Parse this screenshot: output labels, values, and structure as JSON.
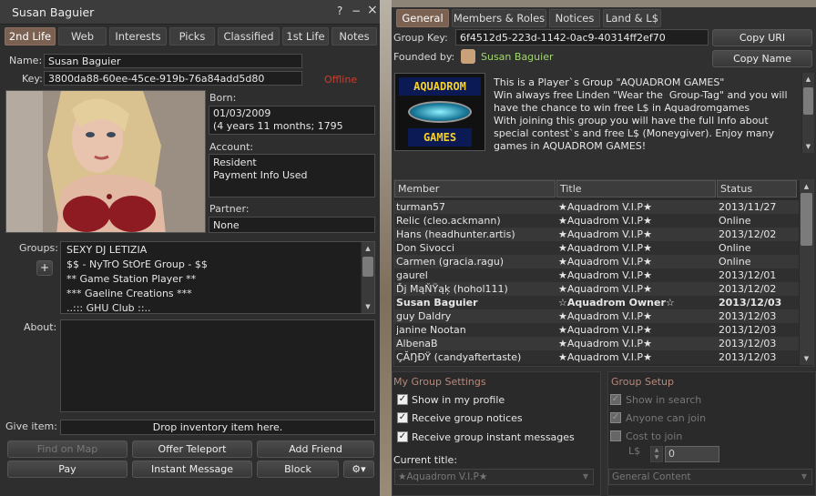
{
  "profile": {
    "title": "Susan Baguier",
    "help_icon": "?",
    "minimize_icon": "−",
    "close_icon": "×",
    "tabs": [
      "2nd Life",
      "Web",
      "Interests",
      "Picks",
      "Classified",
      "1st Life",
      "Notes"
    ],
    "name_label": "Name:",
    "name_value": "Susan Baguier",
    "key_label": "Key:",
    "key_value": "3800da88-60ee-45ce-919b-76a84add5d80",
    "status": "Offline",
    "born_label": "Born:",
    "born_date": "01/03/2009",
    "born_age": "(4 years 11 months; 1795 days)",
    "account_label": "Account:",
    "account_type": "Resident",
    "account_payment": "Payment Info Used",
    "partner_label": "Partner:",
    "partner_value": "None",
    "groups_label": "Groups:",
    "add_group_icon": "+",
    "groups": [
      "SEXY DJ LETIZIA",
      "$$ - NyTrO StOrE Group - $$",
      "** Game Station Player **",
      "*** Gaeline Creations ***",
      "..::: GHU Club ::.."
    ],
    "about_label": "About:",
    "about_value": "",
    "give_item_label": "Give item:",
    "give_item_value": "Drop inventory item here.",
    "buttons": {
      "find_on_map": "Find on Map",
      "offer_teleport": "Offer Teleport",
      "add_friend": "Add Friend",
      "pay": "Pay",
      "instant_message": "Instant Message",
      "block": "Block",
      "gear_icon": "⚙▾"
    }
  },
  "group": {
    "tabs": [
      "General",
      "Members & Roles",
      "Notices",
      "Land & L$"
    ],
    "group_key_label": "Group Key:",
    "group_key_value": "6f4512d5-223d-1142-0ac9-40314ff2ef70",
    "copy_uri": "Copy URI",
    "founded_by_label": "Founded by:",
    "founder": "Susan Baguier",
    "copy_name": "Copy Name",
    "logo_line1": "AQUADROM",
    "logo_line2": "GAMES",
    "description": "This is a Player`s Group \"AQUADROM GAMES\"\nWin always free Linden \"Wear the  Group-Tag\" and you will have the chance to win free L$ in Aquadromgames\nWith joining this group you will have the full Info about special contest`s and free L$ (Moneygiver). Enjoy many games in AQUADROM GAMES!",
    "columns": [
      "Member",
      "Title",
      "Status"
    ],
    "members": [
      {
        "member": "turman57",
        "title": "★Aquadrom V.I.P★",
        "status": "2013/11/27",
        "bold": false
      },
      {
        "member": "Relic (cleo.ackmann)",
        "title": "★Aquadrom V.I.P★",
        "status": "Online",
        "bold": false
      },
      {
        "member": "Hans (headhunter.artis)",
        "title": "★Aquadrom V.I.P★",
        "status": "2013/12/02",
        "bold": false
      },
      {
        "member": "Don Sivocci",
        "title": "★Aquadrom V.I.P★",
        "status": "Online",
        "bold": false
      },
      {
        "member": "Carmen (gracia.ragu)",
        "title": "★Aquadrom V.I.P★",
        "status": "Online",
        "bold": false
      },
      {
        "member": "gaurel",
        "title": "★Aquadrom V.I.P★",
        "status": "2013/12/01",
        "bold": false
      },
      {
        "member": "Ďj MąŇŸąķ (hohol111)",
        "title": "★Aquadrom V.I.P★",
        "status": "2013/12/02",
        "bold": false
      },
      {
        "member": "Susan Baguier",
        "title": "☆Aquadrom Owner☆",
        "status": "2013/12/03",
        "bold": true
      },
      {
        "member": "guy Daldry",
        "title": "★Aquadrom V.I.P★",
        "status": "2013/12/03",
        "bold": false
      },
      {
        "member": "janine Nootan",
        "title": "★Aquadrom V.I.P★",
        "status": "2013/12/03",
        "bold": false
      },
      {
        "member": "AlbenaB",
        "title": "★Aquadrom V.I.P★",
        "status": "2013/12/03",
        "bold": false
      },
      {
        "member": "ÇĂŊĐŸ (candyaftertaste)",
        "title": "★Aquadrom V.I.P★",
        "status": "2013/12/03",
        "bold": false
      }
    ],
    "my_settings_title": "My Group Settings",
    "show_in_profile": "Show in my profile",
    "receive_notices": "Receive group notices",
    "receive_im": "Receive group instant messages",
    "current_title_label": "Current title:",
    "current_title_value": "★Aquadrom V.I.P★",
    "setup_title": "Group Setup",
    "show_in_search": "Show in search",
    "anyone_can_join": "Anyone can join",
    "cost_to_join": "Cost to join",
    "ls_label": "L$",
    "cost_value": "0",
    "maturity_value": "General Content"
  },
  "colors": {
    "accent_tab": "#7a6152",
    "offline": "#d43a2a",
    "founder": "#9fd86a",
    "section_title": "#b8897a"
  }
}
